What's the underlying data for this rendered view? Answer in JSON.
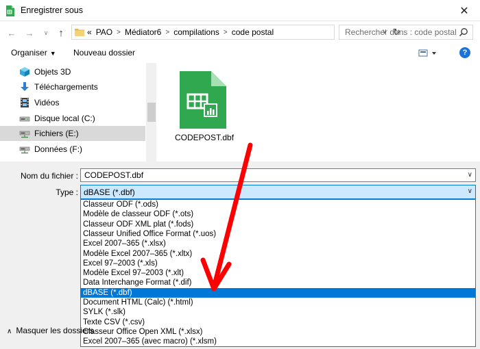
{
  "window": {
    "title": "Enregistrer sous",
    "close_glyph": "✕",
    "accent": "#0078d7"
  },
  "navigation": {
    "back_glyph": "←",
    "forward_glyph": "→",
    "recent_glyph": "∨",
    "up_glyph": "↑",
    "path_prefix": "«",
    "breadcrumbs": [
      "PAO",
      "Médiator6",
      "compilations",
      "code postal"
    ],
    "refresh_glyph": "↻",
    "search_placeholder": "Rechercher dans : code postal"
  },
  "toolbar": {
    "organize_label": "Organiser",
    "new_folder_label": "Nouveau dossier",
    "help_label": "?"
  },
  "nav_pane": {
    "items": [
      {
        "label": "Objets 3D",
        "icon": "cube-3d-icon",
        "selected": false
      },
      {
        "label": "Téléchargements",
        "icon": "download-arrow-icon",
        "selected": false
      },
      {
        "label": "Vidéos",
        "icon": "film-icon",
        "selected": false
      },
      {
        "label": "Disque local (C:)",
        "icon": "drive-icon",
        "selected": false
      },
      {
        "label": "Fichiers (E:)",
        "icon": "network-drive-icon",
        "selected": true
      },
      {
        "label": "Données (F:)",
        "icon": "network-drive-icon",
        "selected": false
      }
    ]
  },
  "files": [
    {
      "name": "CODEPOST.dbf",
      "icon": "spreadsheet-file-icon",
      "color": "#2fa84f"
    }
  ],
  "form": {
    "filename_label": "Nom du fichier :",
    "filename_value": "CODEPOST.dbf",
    "type_label": "Type :",
    "type_value": "dBASE (*.dbf)",
    "hide_folders_label": "Masquer les dossiers"
  },
  "type_options": [
    {
      "label": "Classeur ODF (*.ods)",
      "selected": false
    },
    {
      "label": "Modèle de classeur ODF (*.ots)",
      "selected": false
    },
    {
      "label": "Classeur ODF XML plat (*.fods)",
      "selected": false
    },
    {
      "label": "Classeur Unified Office Format (*.uos)",
      "selected": false
    },
    {
      "label": "Excel 2007–365 (*.xlsx)",
      "selected": false
    },
    {
      "label": "Modèle Excel 2007–365 (*.xltx)",
      "selected": false
    },
    {
      "label": "Excel 97–2003 (*.xls)",
      "selected": false
    },
    {
      "label": "Modèle Excel 97–2003 (*.xlt)",
      "selected": false
    },
    {
      "label": "Data Interchange Format (*.dif)",
      "selected": false
    },
    {
      "label": "dBASE (*.dbf)",
      "selected": true
    },
    {
      "label": "Document HTML (Calc) (*.html)",
      "selected": false
    },
    {
      "label": "SYLK (*.slk)",
      "selected": false
    },
    {
      "label": "Texte CSV (*.csv)",
      "selected": false
    },
    {
      "label": "Classeur Office Open XML (*.xlsx)",
      "selected": false
    },
    {
      "label": "Excel 2007–365 (avec macro) (*.xlsm)",
      "selected": false
    }
  ],
  "annotation": {
    "color": "#ff0000"
  }
}
